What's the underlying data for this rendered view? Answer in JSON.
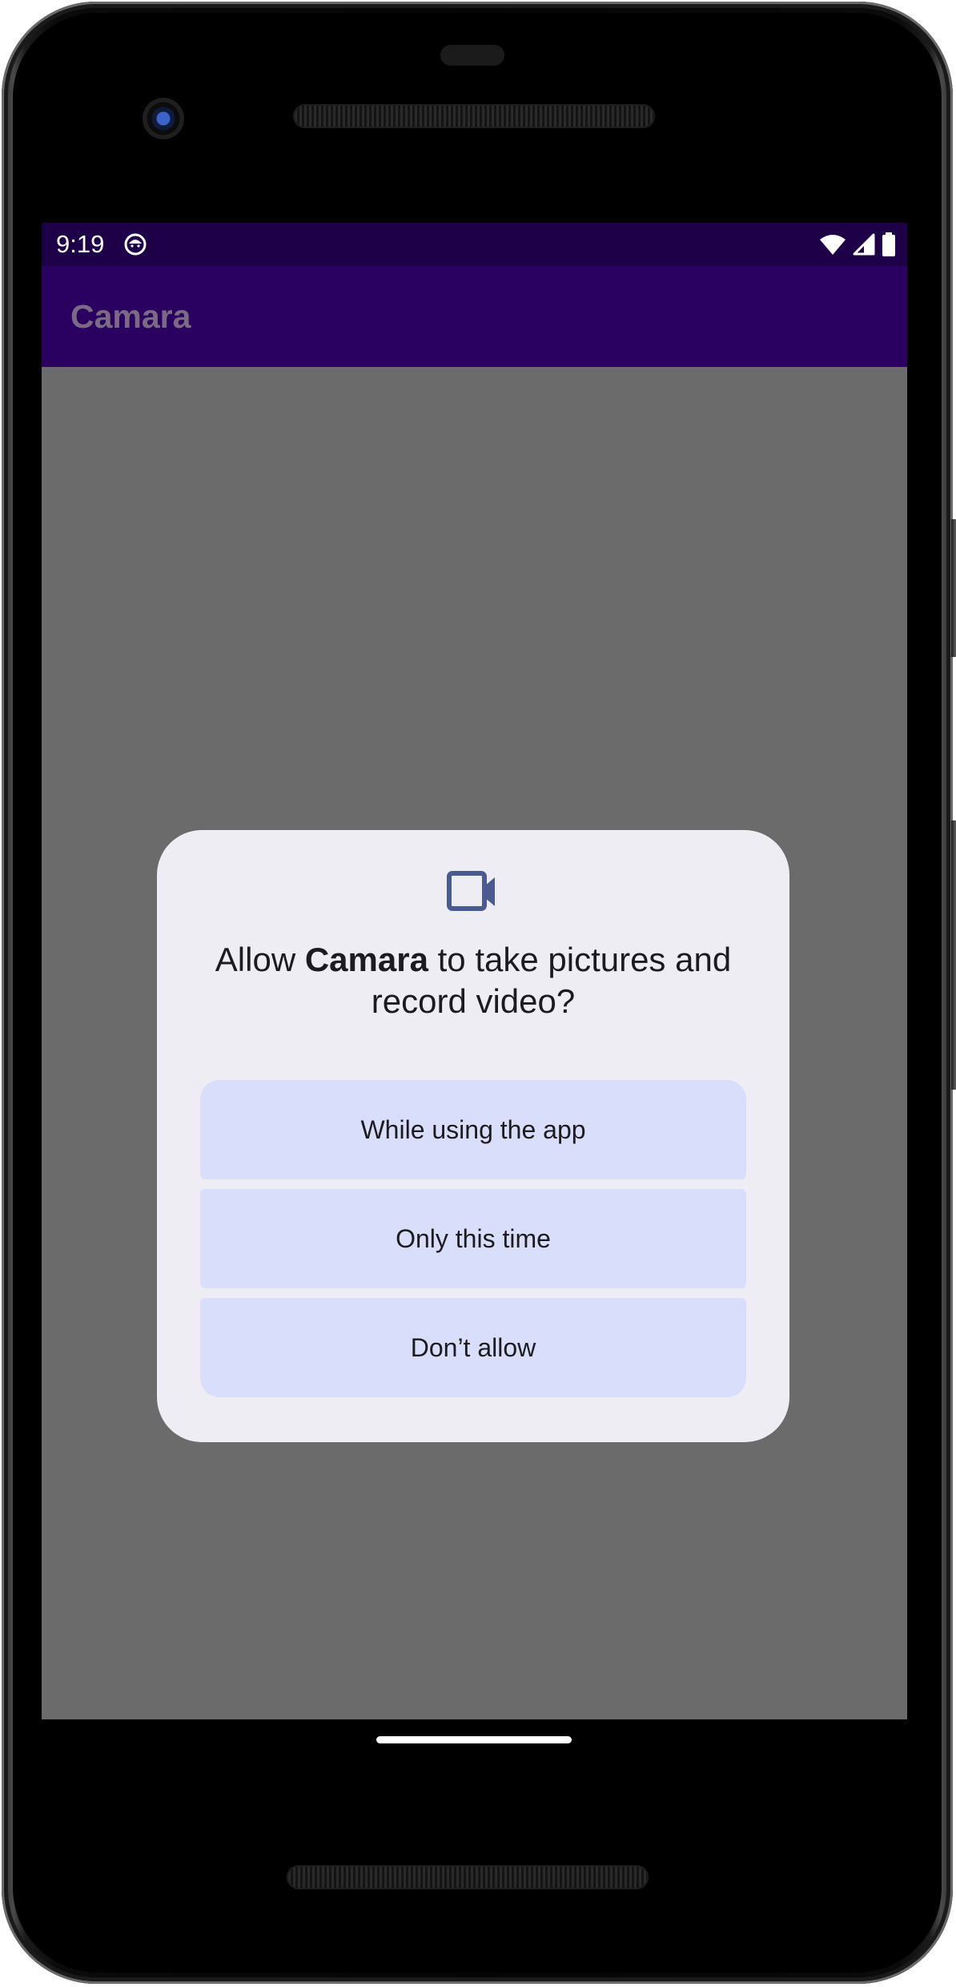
{
  "status_bar": {
    "time": "9:19"
  },
  "app_bar": {
    "title": "Camara"
  },
  "permission_dialog": {
    "icon": "videocam-icon",
    "title_prefix": "Allow ",
    "app_name": "Camara",
    "title_suffix": " to take pictures and record video?",
    "buttons": [
      {
        "label": "While using the app"
      },
      {
        "label": "Only this time"
      },
      {
        "label": "Don’t allow"
      }
    ]
  },
  "colors": {
    "status_bar": "#1e0048",
    "app_bar": "#2a0061",
    "scrim": "#6b6b6b",
    "dialog_surface": "#efedf4",
    "dialog_button": "#d9dffb",
    "icon_accent": "#4a5b92"
  }
}
